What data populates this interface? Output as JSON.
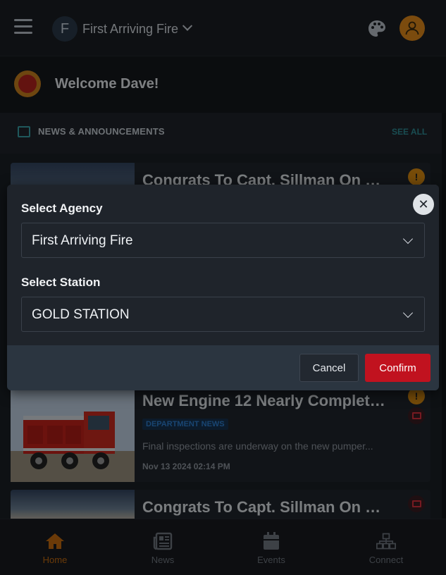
{
  "header": {
    "agency_initial": "F",
    "agency_name": "First Arriving Fire",
    "palette_icon": "palette-icon",
    "user_icon": "user-icon"
  },
  "welcome": {
    "text": "Welcome Dave!"
  },
  "news": {
    "section_title": "NEWS & ANNOUNCEMENTS",
    "see_all": "SEE ALL",
    "items": [
      {
        "title": "Congrats To Capt. Sillman On Re...",
        "badge": "!"
      },
      {
        "title": "New Engine 12 Nearly Complete...",
        "tag": "DEPARTMENT NEWS",
        "description": "Final inspections are underway on the new pumper...",
        "date": "Nov 13 2024 02:14 PM",
        "badge": "!"
      },
      {
        "title": "Congrats To Capt. Sillman On Re..."
      }
    ]
  },
  "modal": {
    "agency_label": "Select Agency",
    "agency_value": "First Arriving Fire",
    "station_label": "Select Station",
    "station_value": "GOLD STATION",
    "cancel_label": "Cancel",
    "confirm_label": "Confirm"
  },
  "bottom_nav": {
    "items": [
      {
        "label": "Home",
        "icon": "home-icon",
        "active": true
      },
      {
        "label": "News",
        "icon": "newspaper-icon",
        "active": false
      },
      {
        "label": "Events",
        "icon": "calendar-icon",
        "active": false
      },
      {
        "label": "Connect",
        "icon": "network-icon",
        "active": false
      }
    ]
  },
  "colors": {
    "accent_orange": "#c46a10",
    "confirm_red": "#c1121f",
    "teal": "#3aa0a8"
  }
}
